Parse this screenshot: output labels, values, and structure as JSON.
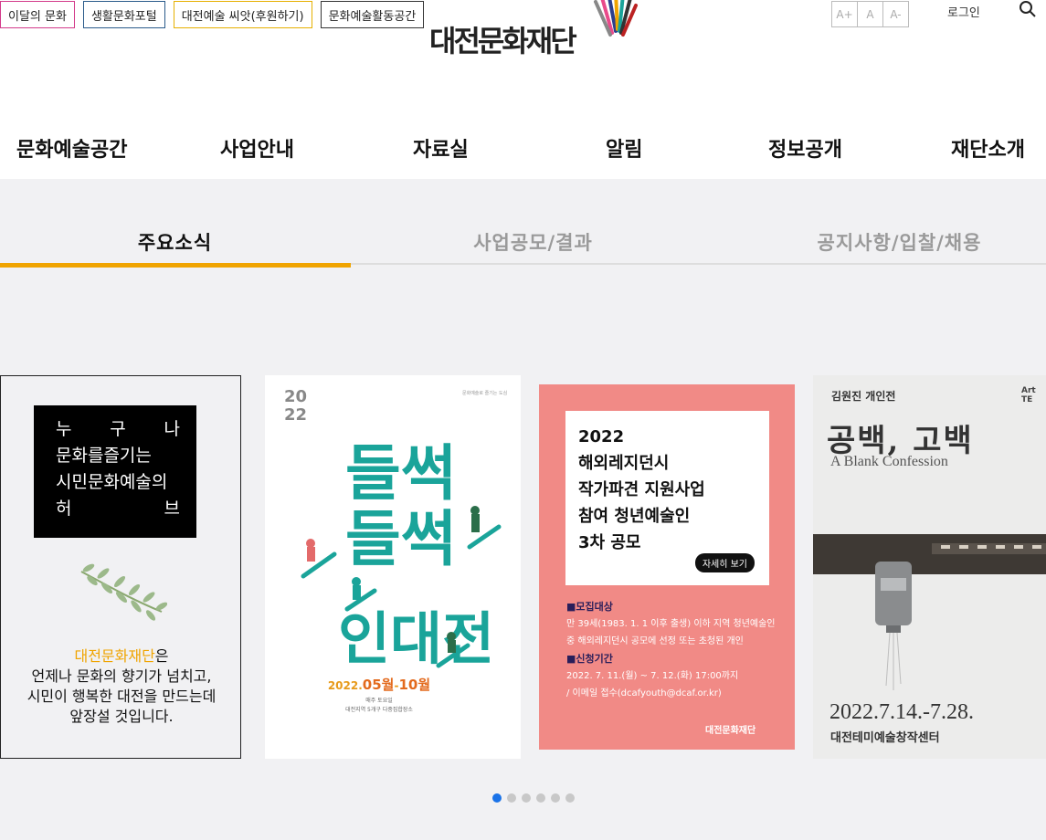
{
  "quick_links": [
    "이달의 문화",
    "생활문화포털",
    "대전예술 씨앗(후원하기)",
    "문화예술활동공간"
  ],
  "logo": {
    "text": "대전문화재단"
  },
  "font_size": {
    "increase": "A+",
    "default": "A",
    "decrease": "A-"
  },
  "login": "로그인",
  "gnb": [
    "문화예술공간",
    "사업안내",
    "자료실",
    "알림",
    "정보공개",
    "재단소개"
  ],
  "tabs": [
    "주요소식",
    "사업공모/결과",
    "공지사항/입찰/채용"
  ],
  "intro_card": {
    "lines": [
      "누 구 나",
      "문화를즐기는",
      "시민문화예술의",
      "허 브"
    ],
    "brand": "대전문화재단",
    "brand_suffix": "은",
    "desc_1": "언제나 문화의 향기가 넘치고,",
    "desc_2": "시민이 행복한 대전을 만드는데",
    "desc_3": "앞장설 것입니다."
  },
  "poster1": {
    "year_top": "20",
    "year_bottom": "22",
    "top_note": "문화예술로 즐기는 도심",
    "title_1": "들썩",
    "title_2": "들썩",
    "title_3": "인대전",
    "date_prefix": "2022.",
    "date_month_start": "05월",
    "date_sep": "-",
    "date_month_end": "10월",
    "sub_1": "매주 토요일",
    "sub_2": "대전지역 5개구 다중집합장소"
  },
  "poster2": {
    "title_lines": [
      "2022",
      "해외레지던시",
      "작가파견 지원사업",
      "참여 청년예술인",
      "3차 공모"
    ],
    "button": "자세히 보기",
    "section1_head": "모집대상",
    "section1_line1": "만 39세(1983. 1. 1 이후 출생) 이하 지역 청년예술인",
    "section1_line2": "중 해외레지던시 공모에 선정 또는 초청된 개인",
    "section2_head": "신청기간",
    "section2_line1": "2022. 7. 11.(월) ~ 7. 12.(화) 17:00까지",
    "section2_line2": "/ 이메일 접수(dcafyouth@dcaf.or.kr)",
    "footer": "대전문화재단"
  },
  "poster3": {
    "kicker": "김원진 개인전",
    "corner_1": "Art",
    "corner_2": "TE",
    "title": "공백, 고백",
    "subtitle": "A Blank Confession",
    "date": "2022.7.14.-7.28.",
    "place": "대전테미예술창작센터"
  },
  "pagination": {
    "count": 6,
    "active": 0
  },
  "colors": {
    "accent": "#f0a400",
    "tab_active_text": "#111111",
    "tab_inactive_text": "#9a9a9a",
    "poster2_bg": "#f18a86",
    "poster1_green": "#1aa49a",
    "dot_active": "#1a73e8"
  }
}
